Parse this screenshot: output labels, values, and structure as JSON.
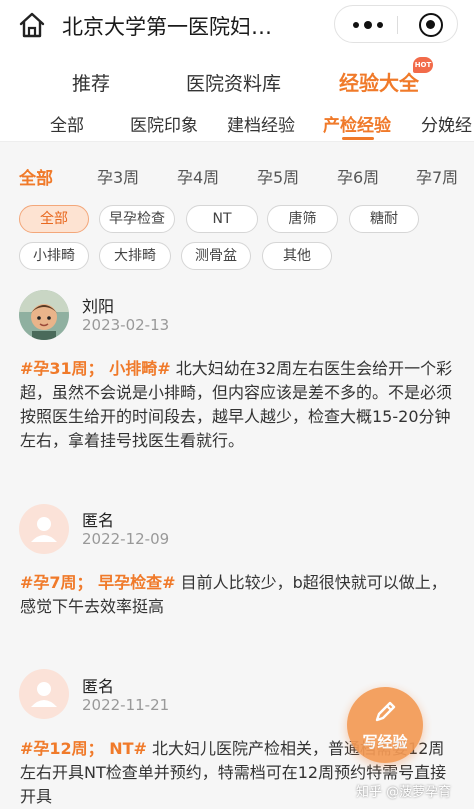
{
  "header": {
    "title": "北京大学第一医院妇…",
    "home_icon": "home-icon",
    "more_icon": "more-dots-icon",
    "close_icon": "target-close-icon"
  },
  "primary_tabs": [
    {
      "label": "推荐",
      "active": false
    },
    {
      "label": "医院资料库",
      "active": false
    },
    {
      "label": "经验大全",
      "active": true
    }
  ],
  "hot_badge": "HOT",
  "secondary_tabs": [
    {
      "label": "全部",
      "active": false
    },
    {
      "label": "医院印象",
      "active": false
    },
    {
      "label": "建档经验",
      "active": false
    },
    {
      "label": "产检经验",
      "active": true
    },
    {
      "label": "分娩经",
      "active": false
    }
  ],
  "weeks": [
    {
      "label": "全部",
      "active": true
    },
    {
      "label": "孕3周"
    },
    {
      "label": "孕4周"
    },
    {
      "label": "孕5周"
    },
    {
      "label": "孕6周"
    },
    {
      "label": "孕7周"
    }
  ],
  "chips": [
    {
      "label": "全部",
      "active": true
    },
    {
      "label": "早孕检查"
    },
    {
      "label": "NT"
    },
    {
      "label": "唐筛"
    },
    {
      "label": "糖耐"
    },
    {
      "label": "小排畸"
    },
    {
      "label": "大排畸"
    },
    {
      "label": "测骨盆"
    },
    {
      "label": "其他"
    }
  ],
  "posts": [
    {
      "name": "刘阳",
      "date": "2023-02-13",
      "tags": "#孕31周； 小排畸#",
      "text": " 北大妇幼在32周左右医生会给开一个彩超，虽然不会说是小排畸，但内容应该是差不多的。不是必须按照医生给开的时间段去，越早人越少，检查大概15-20分钟左右，拿着挂号找医生看就行。"
    },
    {
      "name": "匿名",
      "date": "2022-12-09",
      "tags": "#孕7周； 早孕检查#",
      "text": " 目前人比较少，b超很快就可以做上，感觉下午去效率挺高"
    },
    {
      "name": "匿名",
      "date": "2022-11-21",
      "tags": "#孕12周； NT#",
      "text": " 北大妇儿医院产检相关，普通档需要12周左右开具NT检查单并预约，特需档可在12周预约特需号直接开具"
    }
  ],
  "fab_label": "写经验",
  "watermark": "知乎 @菠萝孕育",
  "colors": {
    "accent": "#f07a2a",
    "chip_active_bg": "#fde3d2"
  }
}
